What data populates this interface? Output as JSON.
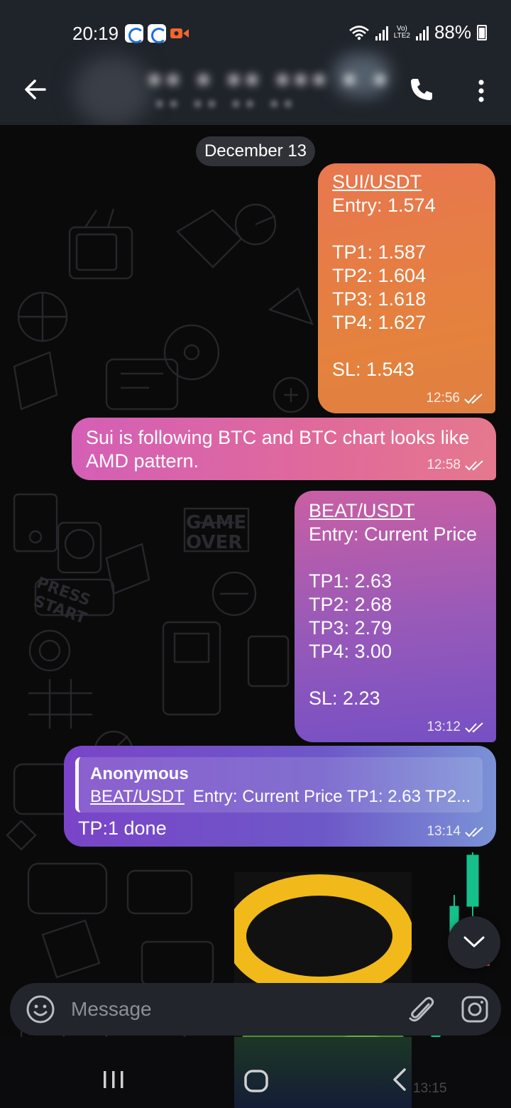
{
  "status_bar": {
    "time": "20:19",
    "volte_line1": "Vo)",
    "volte_line2": "LTE2",
    "battery": "88%"
  },
  "header": {
    "chat_title": "■■ ■ ■■ ■■■ ■ ■",
    "chat_subtitle": "■■ ■■ ■■ ■■"
  },
  "chat": {
    "date_chip": "December 13",
    "messages": [
      {
        "title": "SUI/USDT",
        "body": "\nEntry: 1.574\n\nTP1: 1.587\nTP2: 1.604\nTP3: 1.618\nTP4: 1.627\n\nSL: 1.543",
        "time": "12:56"
      },
      {
        "body": "Sui is following BTC and BTC chart looks like AMD pattern.",
        "time": "12:58"
      },
      {
        "title": "BEAT/USDT",
        "body": "\nEntry: Current Price\n\nTP1: 2.63\nTP2: 2.68\nTP3: 2.79\nTP4: 3.00\n\nSL: 2.23",
        "time": "13:12"
      },
      {
        "reply_name": "Anonymous",
        "reply_title": "BEAT/USDT",
        "reply_text": "Entry: Current Price  TP1: 2.63 TP2...",
        "body": "TP:1 done",
        "time": "13:14"
      }
    ],
    "hidden_time": "13:15"
  },
  "composer": {
    "placeholder": "Message"
  },
  "icons": {
    "back": "arrow-left-icon",
    "call": "phone-icon",
    "menu": "more-vertical-icon",
    "emoji": "emoji-icon",
    "attach": "paperclip-icon",
    "camera": "camera-icon",
    "scroll_down": "chevron-down-icon"
  },
  "colors": {
    "app_bar": "#1f232a",
    "bubble_orange": "#e4823d",
    "bubble_pink": "#d45fb6",
    "bubble_purple": "#7650c4",
    "check_marks": "#ffffff"
  }
}
